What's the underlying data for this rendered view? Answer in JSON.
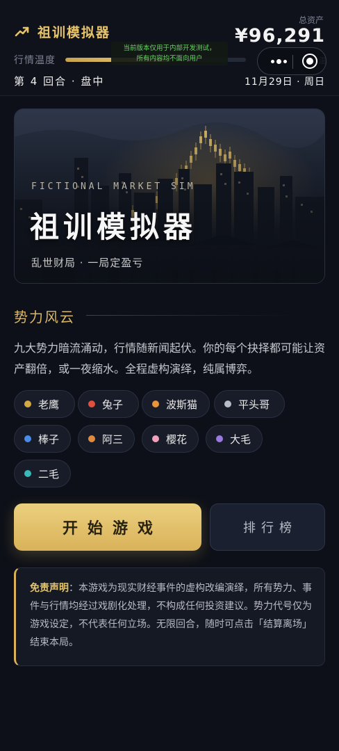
{
  "header": {
    "app_title": "祖训模拟器",
    "total_assets_label": "总资产",
    "total_assets_value": "¥96,291",
    "mood_label": "行情温度",
    "mood_level": 0.58,
    "edge_fragment": "温",
    "round_text": "第 4 回合 · 盘中",
    "date_text": "11月29日 · 周日",
    "dev_notice_line1": "当前版本仅用于内部开发测试，",
    "dev_notice_line2": "所有内容均不面向用户"
  },
  "hero": {
    "subtitle_en": "FICTIONAL MARKET SIM",
    "title": "祖训模拟器",
    "tagline": "乱世财局 · 一局定盈亏"
  },
  "factions": {
    "section_title": "势力风云",
    "description": "九大势力暗流涌动，行情随新闻起伏。你的每个抉择都可能让资产翻倍，或一夜缩水。全程虚构演绎，纯属博弈。",
    "items": [
      {
        "label": "老鹰",
        "color": "#d4a843"
      },
      {
        "label": "兔子",
        "color": "#e0503e"
      },
      {
        "label": "波斯猫",
        "color": "#e8943a"
      },
      {
        "label": "平头哥",
        "color": "#b8bcc8"
      },
      {
        "label": "棒子",
        "color": "#4a8be8"
      },
      {
        "label": "阿三",
        "color": "#e08a3e"
      },
      {
        "label": "樱花",
        "color": "#f0a0b8"
      },
      {
        "label": "大毛",
        "color": "#9a7ae0"
      },
      {
        "label": "二毛",
        "color": "#3ab8b8"
      }
    ]
  },
  "actions": {
    "start_label": "开始游戏",
    "rank_label": "排行榜"
  },
  "disclaimer": {
    "heading": "免责声明",
    "body": "：本游戏为现实财经事件的虚构改编演绎，所有势力、事件与行情均经过戏剧化处理，不构成任何投资建议。势力代号仅为游戏设定，不代表任何立场。无限回合，随时可点击「结算离场」结束本局。"
  },
  "colors": {
    "accent_gold": "#d9b25a",
    "background": "#0d1018"
  },
  "icons": {
    "brand": "trend-up-icon",
    "capsule_more": "more-dots-icon",
    "capsule_close": "target-close-icon"
  }
}
